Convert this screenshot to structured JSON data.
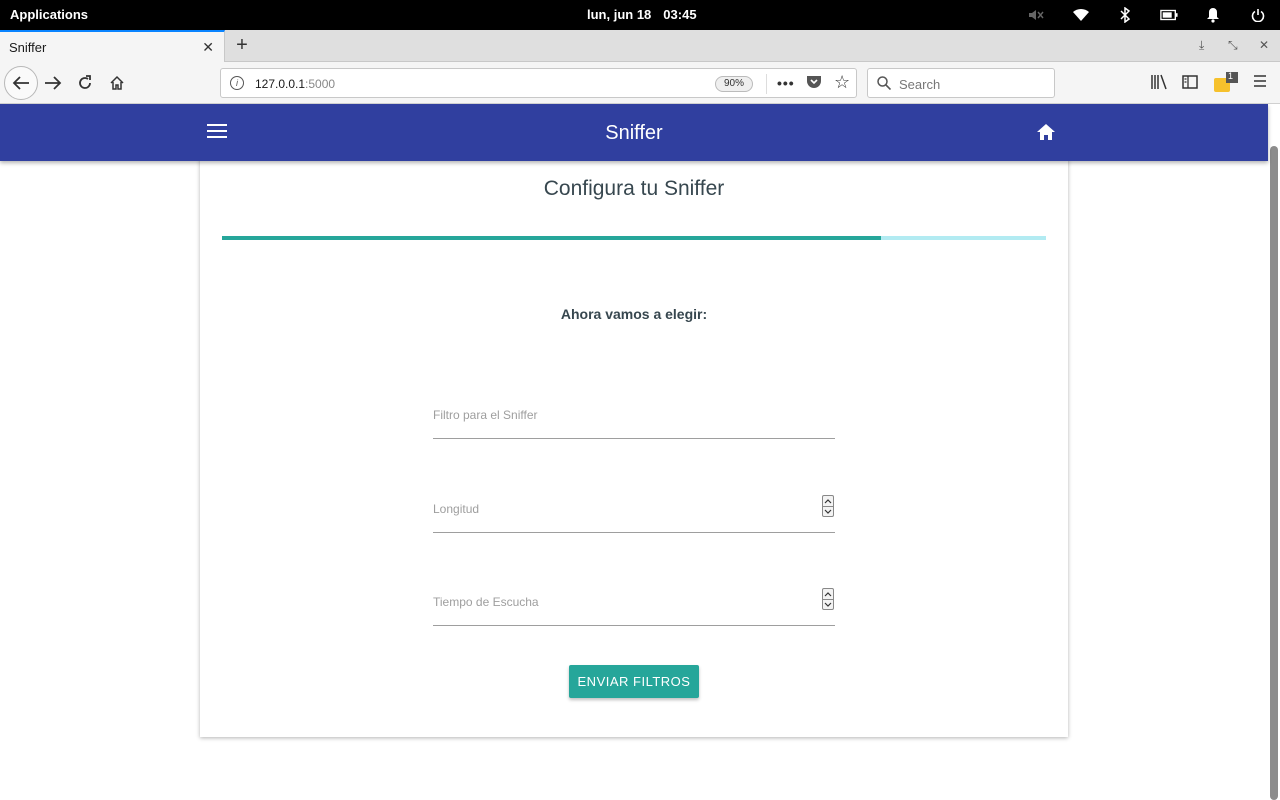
{
  "system": {
    "apps_label": "Applications",
    "date": "lun, jun 18",
    "time": "03:45"
  },
  "browser": {
    "tab_title": "Sniffer",
    "url_host": "127.0.0.1",
    "url_port": ":5000",
    "zoom": "90%",
    "search_placeholder": "Search",
    "notification_count": "1"
  },
  "app": {
    "brand": "Sniffer",
    "card_title": "Configura tu Sniffer",
    "progress_fraction": 0.8,
    "subtitle": "Ahora vamos a elegir:",
    "fields": [
      {
        "label": "Filtro para el Sniffer",
        "type": "text"
      },
      {
        "label": "Longitud",
        "type": "number"
      },
      {
        "label": "Tiempo de Escucha",
        "type": "number"
      }
    ],
    "submit_label": "ENVIAR FILTROS"
  },
  "colors": {
    "appbar": "#303f9f",
    "accent": "#26a69a",
    "progress_track": "#b2ebf2"
  }
}
